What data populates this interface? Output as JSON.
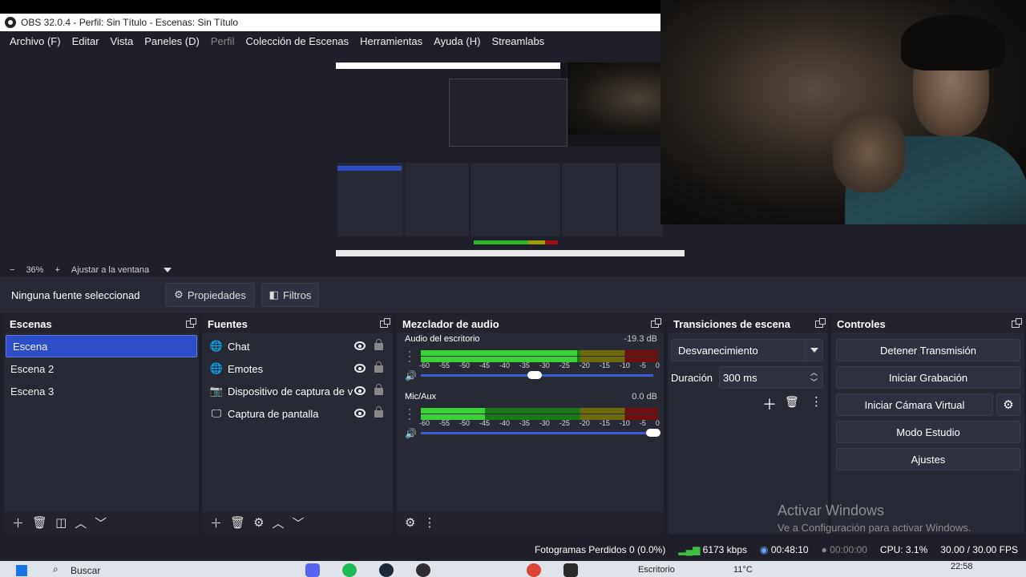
{
  "window": {
    "title": "OBS 32.0.4 - Perfil: Sin Título - Escenas: Sin Título"
  },
  "menu": {
    "items": [
      "Archivo (F)",
      "Editar",
      "Vista",
      "Paneles (D)",
      "Perfil",
      "Colección de Escenas",
      "Herramientas",
      "Ayuda (H)",
      "Streamlabs"
    ]
  },
  "zoom": {
    "minus": "−",
    "value": "36%",
    "plus": "+",
    "fit_label": "Ajustar a la ventana"
  },
  "source_toolbar": {
    "no_selection": "Ninguna fuente seleccionad",
    "properties": "Propiedades",
    "filters": "Filtros"
  },
  "scenes": {
    "title": "Escenas",
    "items": [
      "Escena",
      "Escena 2",
      "Escena 3"
    ],
    "selected_index": 0
  },
  "sources": {
    "title": "Fuentes",
    "items": [
      {
        "label": "Chat",
        "icon": "globe-icon"
      },
      {
        "label": "Emotes",
        "icon": "globe-icon"
      },
      {
        "label": "Dispositivo de captura de v",
        "icon": "camera-icon"
      },
      {
        "label": "Captura de pantalla",
        "icon": "monitor-icon"
      }
    ]
  },
  "mixer": {
    "title": "Mezclador de audio",
    "channels": [
      {
        "name": "Audio del escritorio",
        "db": "-19.3 dB",
        "level": 0.66,
        "volume": 0.49
      },
      {
        "name": "Mic/Aux",
        "db": "0.0 dB",
        "level": 0.27,
        "volume": 1.0
      }
    ],
    "ticks": [
      "-60",
      "-55",
      "-50",
      "-45",
      "-40",
      "-35",
      "-30",
      "-25",
      "-20",
      "-15",
      "-10",
      "-5",
      "0"
    ]
  },
  "transitions": {
    "title": "Transiciones de escena",
    "selected": "Desvanecimiento",
    "duration_label": "Duración",
    "duration_value": "300 ms"
  },
  "controls": {
    "title": "Controles",
    "buttons": [
      "Detener Transmisión",
      "Iniciar Grabación",
      "Iniciar Cámara Virtual",
      "Modo Estudio",
      "Ajustes"
    ]
  },
  "status": {
    "dropped": "Fotogramas Perdidos 0 (0.0%)",
    "bitrate": "6173 kbps",
    "stream_time": "00:48:10",
    "rec_time": "00:00:00",
    "cpu": "CPU: 3.1%",
    "fps": "30.00 / 30.00 FPS"
  },
  "watermark": {
    "line1": "Activar Windows",
    "line2": "Ve a Configuración para activar Windows."
  },
  "taskbar": {
    "search": "Buscar",
    "desktop": "Escritorio",
    "temp": "11°C",
    "clock": "22:58"
  },
  "colors": {
    "accent": "#2d4ec7",
    "panel": "#272935",
    "bg": "#1e1f29"
  }
}
